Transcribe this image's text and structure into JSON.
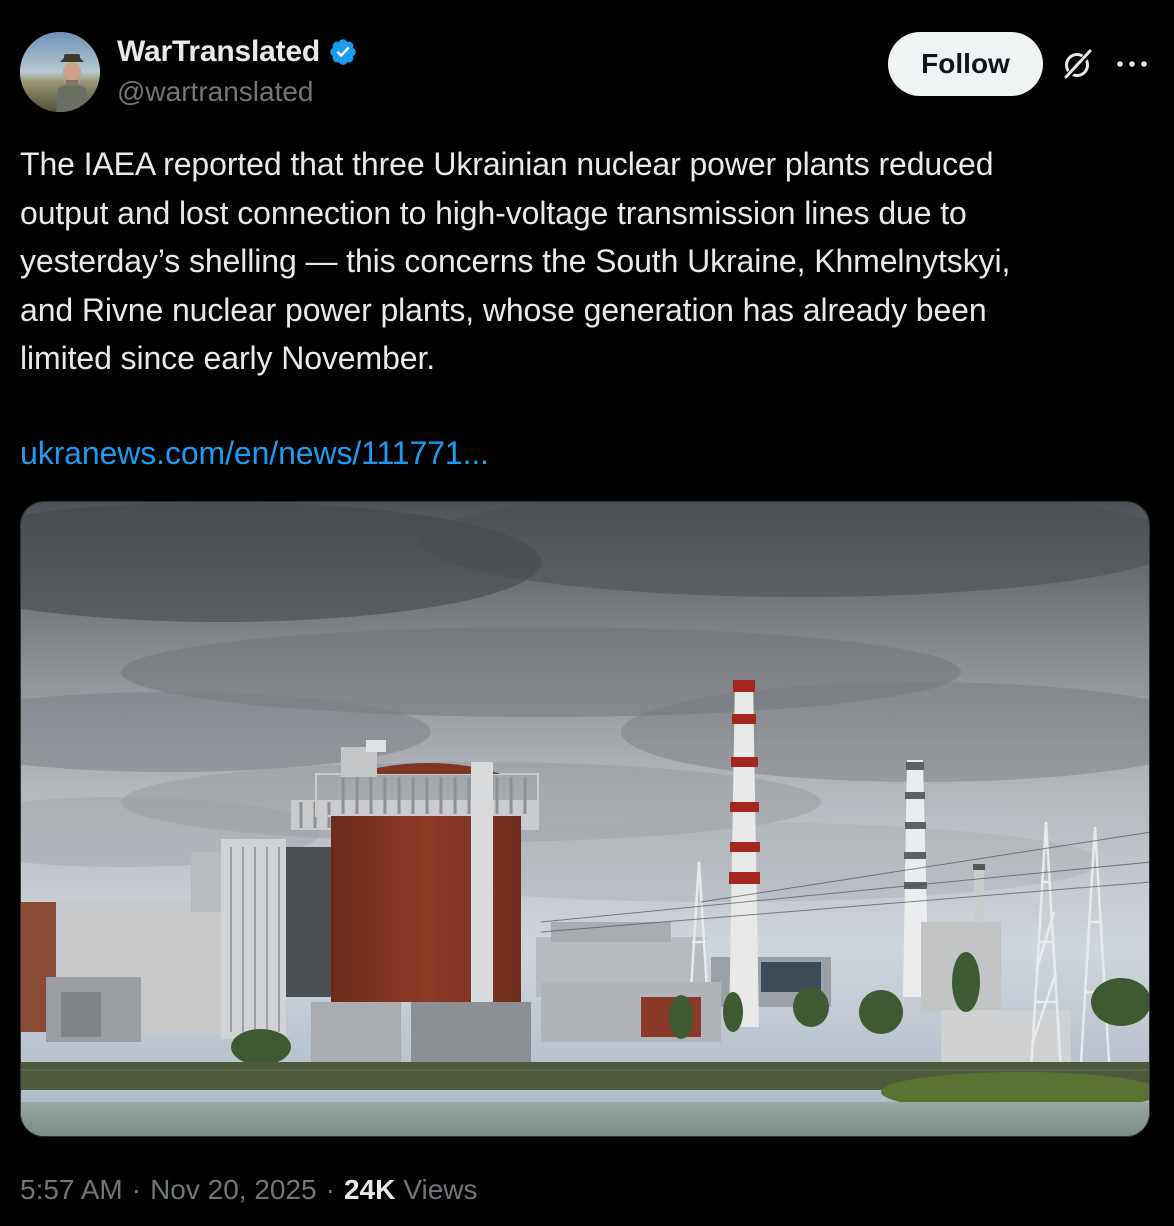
{
  "author": {
    "display_name": "WarTranslated",
    "handle": "@wartranslated",
    "verified": true,
    "avatar_icon": "profile-photo-person-with-hat"
  },
  "actions": {
    "follow_label": "Follow",
    "grok_icon": "grok-icon",
    "more_icon": "more-horizontal-icon"
  },
  "tweet": {
    "text": "The IAEA reported that three Ukrainian nuclear power plants reduced\noutput and lost connection to high-voltage transmission lines due to\nyesterday’s shelling — this concerns the South Ukraine, Khmelnytskyi,\nand Rivne nuclear power plants, whose generation has already been\nlimited since early November.",
    "link_text": "ukranews.com/en/news/111771...",
    "media_description_icon": "nuclear-power-plant-photo"
  },
  "meta": {
    "time": "5:57 AM",
    "separator": "·",
    "date": "Nov 20, 2025",
    "views_count": "24K",
    "views_label": "Views"
  },
  "colors": {
    "background": "#000000",
    "text_primary": "#e7e9ea",
    "text_secondary": "#71767b",
    "link": "#1d9bf0",
    "verified": "#1d9bf0",
    "follow_bg": "#eff3f4"
  }
}
